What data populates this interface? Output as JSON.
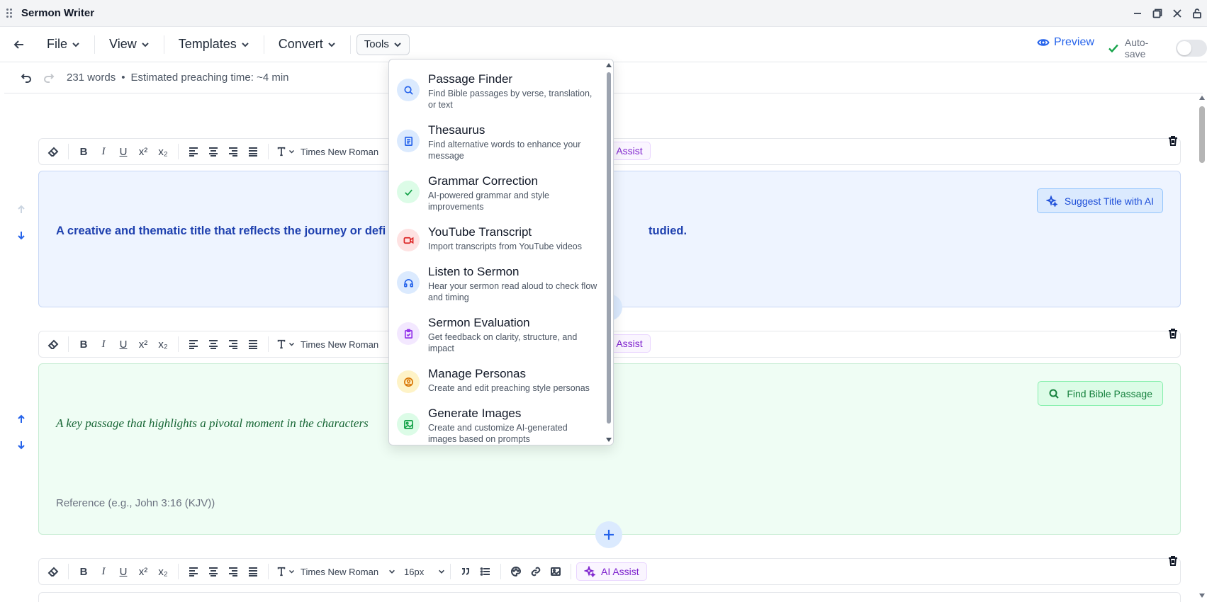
{
  "window": {
    "title": "Sermon Writer"
  },
  "menubar": {
    "items": [
      {
        "label": "File"
      },
      {
        "label": "View"
      },
      {
        "label": "Templates"
      },
      {
        "label": "Convert"
      },
      {
        "label": "Tools"
      }
    ],
    "preview_label": "Preview",
    "autosave_label": "Auto-save",
    "autosave_enabled": false
  },
  "status": {
    "word_count": "231 words",
    "separator": "•",
    "preaching_time": "Estimated preaching time: ~4 min"
  },
  "toolbar": {
    "font_family": "Times New Roman",
    "font_size": "16px",
    "ai_assist_label": "AI Assist"
  },
  "blocks": {
    "title": {
      "text": "A creative and thematic title that reflects the journey or defi",
      "text_tail": "tudied.",
      "suggest_label": "Suggest Title with AI",
      "bg_color": "#eef4ff"
    },
    "passage": {
      "text": "A key passage that highlights a pivotal moment in the characters",
      "reference_placeholder": "Reference (e.g., John 3:16 (KJV))",
      "find_label": "Find Bible Passage",
      "bg_color": "#effdf4"
    }
  },
  "tools_menu": {
    "items": [
      {
        "title": "Passage Finder",
        "desc": "Find Bible passages by verse, translation, or text",
        "icon": "search-icon",
        "color": "#2563eb",
        "bg": "#dbeafe"
      },
      {
        "title": "Thesaurus",
        "desc": "Find alternative words to enhance your message",
        "icon": "book-icon",
        "color": "#2563eb",
        "bg": "#dbeafe"
      },
      {
        "title": "Grammar Correction",
        "desc": "AI-powered grammar and style improvements",
        "icon": "check-icon",
        "color": "#16a34a",
        "bg": "#dcfce7"
      },
      {
        "title": "YouTube Transcript",
        "desc": "Import transcripts from YouTube videos",
        "icon": "video-icon",
        "color": "#dc2626",
        "bg": "#fee2e2"
      },
      {
        "title": "Listen to Sermon",
        "desc": "Hear your sermon read aloud to check flow and timing",
        "icon": "headphones-icon",
        "color": "#2563eb",
        "bg": "#dbeafe"
      },
      {
        "title": "Sermon Evaluation",
        "desc": "Get feedback on clarity, structure, and impact",
        "icon": "clipboard-check-icon",
        "color": "#9333ea",
        "bg": "#f3e8ff"
      },
      {
        "title": "Manage Personas",
        "desc": "Create and edit preaching style personas",
        "icon": "user-circle-icon",
        "color": "#d97706",
        "bg": "#fef3c7"
      },
      {
        "title": "Generate Images",
        "desc": "Create and customize AI-generated images based on prompts",
        "icon": "image-icon",
        "color": "#16a34a",
        "bg": "#dcfce7"
      }
    ]
  }
}
